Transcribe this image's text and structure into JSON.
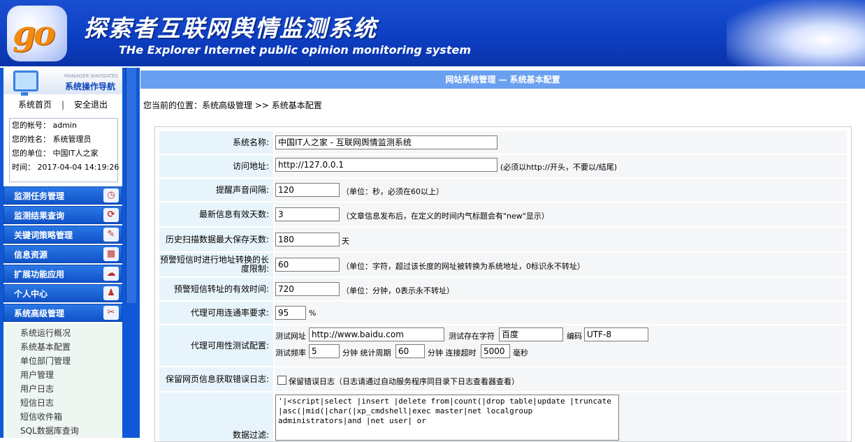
{
  "header": {
    "logo_text": "go",
    "title_cn": "探索者互联网舆情监测系统",
    "title_en": "THe Explorer Internet public opinion monitoring system"
  },
  "sidebar": {
    "nav_small": "MANAGER NAVIGATES",
    "nav_title": "系统操作导航",
    "home_link": "系统首页",
    "logout_link": "安全退出",
    "separator": "|",
    "user": {
      "account": "您的帐号：  admin",
      "name": "您的姓名：  系统管理员",
      "unit": "您的单位：  中国IT人之家",
      "time": "时间：  2017-04-04 14:19:26"
    },
    "menu": [
      {
        "label": "监测任务管理",
        "icon": "clock-icon",
        "glyph": "◷"
      },
      {
        "label": "监测结果查询",
        "icon": "refresh-icon",
        "glyph": "⟳"
      },
      {
        "label": "关键词策略管理",
        "icon": "edit-icon",
        "glyph": "✎"
      },
      {
        "label": "信息资源",
        "icon": "picture-icon",
        "glyph": "▦"
      },
      {
        "label": "扩展功能应用",
        "icon": "cloud-icon",
        "glyph": "☁"
      },
      {
        "label": "个人中心",
        "icon": "person-icon",
        "glyph": "♟"
      },
      {
        "label": "系统高级管理",
        "icon": "tools-icon",
        "glyph": "✂"
      }
    ],
    "submenu": [
      "系统运行概况",
      "系统基本配置",
      "单位部门管理",
      "用户管理",
      "用户日志",
      "短信日志",
      "短信收件箱",
      "SQL数据库查询"
    ]
  },
  "main": {
    "title": "网站系统管理 — 系统基本配置",
    "breadcrumb": "您当前的位置：系统高级管理 >> 系统基本配置",
    "form": {
      "sys_name": {
        "label": "系统名称:",
        "value": "中国IT人之家 - 互联网舆情监测系统"
      },
      "url": {
        "label": "访问地址:",
        "value": "http://127.0.0.1",
        "note": "(必须以http://开头，不要以/结尾)"
      },
      "beep": {
        "label": "提醒声音间隔:",
        "value": "120",
        "note": "（单位：秒，必须在60以上）"
      },
      "valid_days": {
        "label": "最新信息有效天数:",
        "value": "3",
        "note": "（文章信息发布后，在定义的时间内气标题会有\"new\"显示）"
      },
      "keep_days": {
        "label": "历史扫描数据最大保存天数:",
        "value": "180",
        "note": "天"
      },
      "sms_len": {
        "label": "预警短信时进行地址转换的长度限制:",
        "value": "60",
        "note": "（单位：字符，超过该长度的网址被转换为系统地址，0标识永不转址）"
      },
      "sms_valid": {
        "label": "预警短信转址的有效时间:",
        "value": "720",
        "note": "（单位：分钟，0表示永不转址）"
      },
      "proxy_rate": {
        "label": "代理可用连通率要求:",
        "value": "95",
        "note": "%"
      },
      "proxy_test": {
        "label": "代理可用性测试配置:",
        "url_label": "测试网址",
        "url_value": "http://www.baidu.com",
        "str_label": "测试存在字符",
        "str_value": "百度",
        "enc_label": "编码",
        "enc_value": "UTF-8",
        "freq_label": "测试频率",
        "freq_value": "5",
        "period_label": "分钟 统计周期",
        "period_value": "60",
        "timeout_label": "分钟 连接超时",
        "timeout_value": "5000",
        "ms_label": "毫秒"
      },
      "keep_err": {
        "label": "保留网页信息获取错误日志:",
        "checkbox_label": "保留错误日志（日志请通过自动服务程序同目录下日志查看器查看）"
      },
      "filter": {
        "label": "数据过滤:",
        "value": "'|<script|select |insert |delete from|count(|drop table|update |truncate |asc(|mid(|char(|xp_cmdshell|exec master|net localgroup administrators|and |net user| or"
      }
    }
  }
}
